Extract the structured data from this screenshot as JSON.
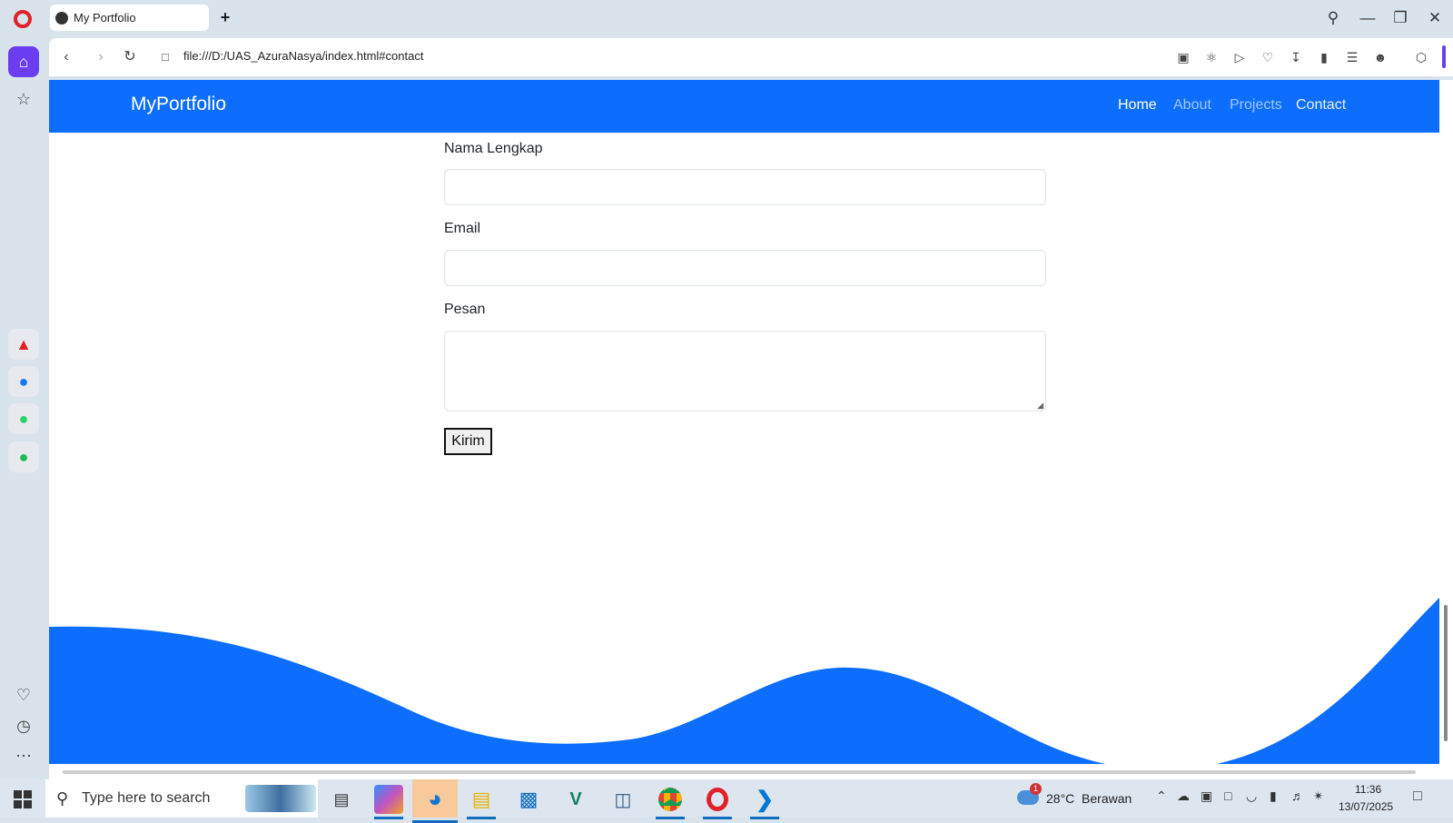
{
  "browser": {
    "tab_title": "My Portfolio",
    "url": "file:///D:/UAS_AzuraNasya/index.html#contact"
  },
  "page": {
    "brand": "MyPortfolio",
    "nav": [
      {
        "label": "Home",
        "color": "#ffffff"
      },
      {
        "label": "About",
        "color": "#9ec5fe"
      },
      {
        "label": "Projects",
        "color": "#9ec5fe"
      },
      {
        "label": "Contact",
        "color": "#e7f0ff"
      }
    ],
    "form": {
      "name_label": "Nama Lengkap",
      "email_label": "Email",
      "message_label": "Pesan",
      "submit_label": "Kirim"
    },
    "colors": {
      "primary": "#0d6efd"
    }
  },
  "taskbar": {
    "search_placeholder": "Type here to search",
    "weather": "28°C  Berawan",
    "time": "11:36",
    "date": "13/07/2025",
    "notification_count": "1"
  }
}
